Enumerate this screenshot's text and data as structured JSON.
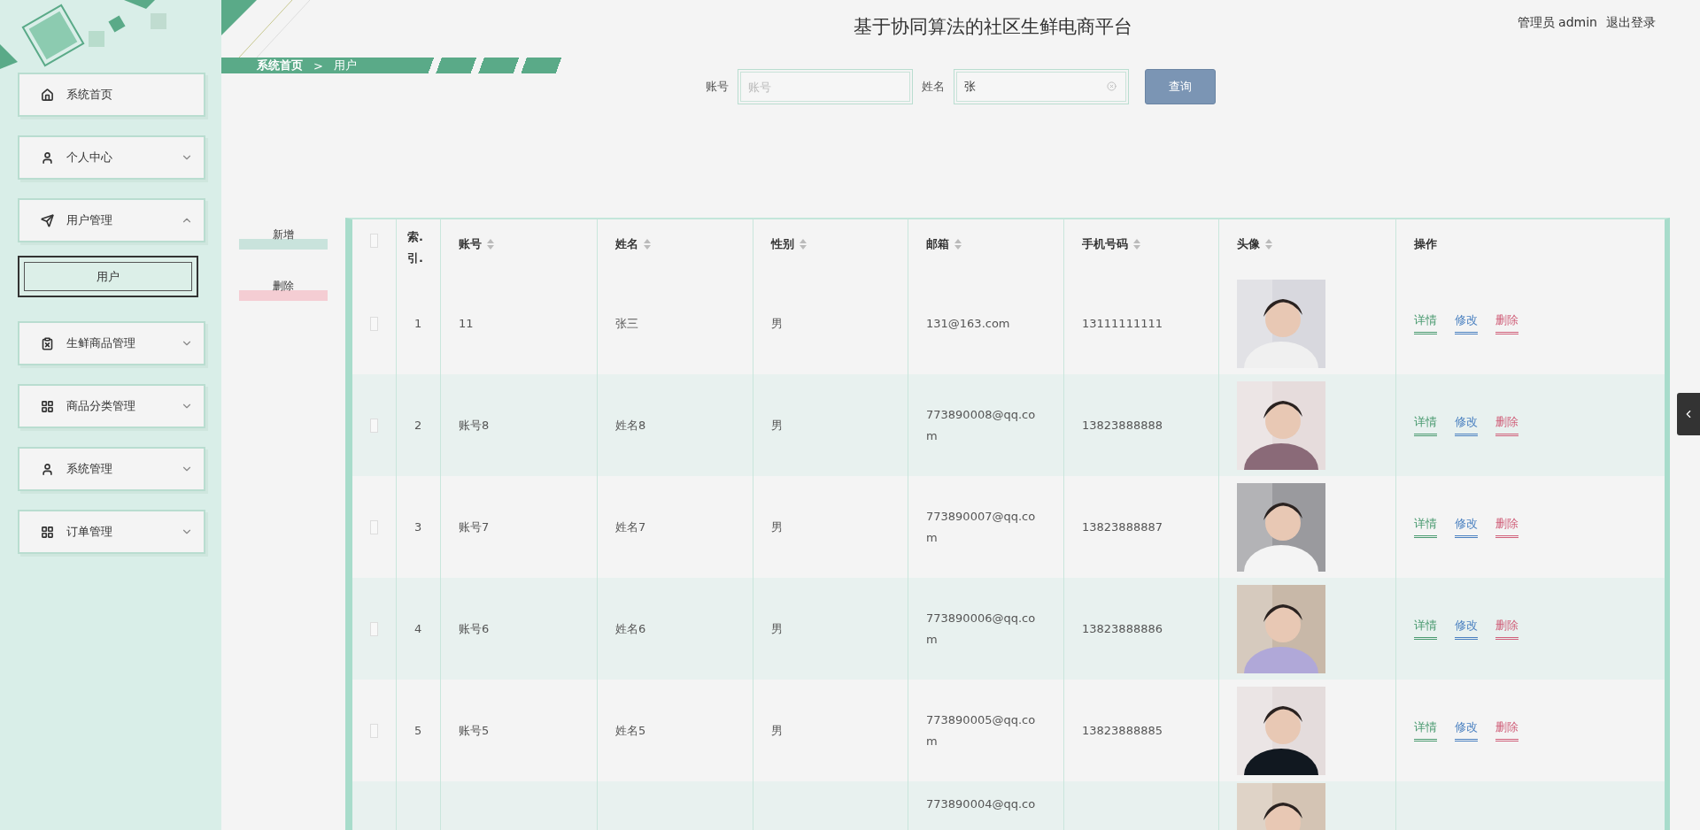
{
  "header": {
    "title": "基于协同算法的社区生鲜电商平台",
    "user_label": "管理员 admin",
    "logout": "退出登录"
  },
  "breadcrumb": [
    "系统首页",
    "用户"
  ],
  "breadcrumb_separator": ">",
  "sidebar": {
    "items": [
      {
        "label": "系统首页",
        "kind": "home"
      },
      {
        "label": "个人中心",
        "kind": "user",
        "expanded": false
      },
      {
        "label": "用户管理",
        "kind": "send",
        "expanded": true,
        "children": [
          {
            "label": "用户",
            "selected": true
          }
        ]
      },
      {
        "label": "生鲜商品管理",
        "kind": "clipboard",
        "expanded": false
      },
      {
        "label": "商品分类管理",
        "kind": "grid",
        "expanded": false
      },
      {
        "label": "系统管理",
        "kind": "user",
        "expanded": false
      },
      {
        "label": "订单管理",
        "kind": "grid",
        "expanded": false
      }
    ]
  },
  "search": {
    "fields": [
      {
        "label": "账号",
        "placeholder": "账号"
      },
      {
        "label": "姓名",
        "value": "张"
      }
    ],
    "button": "查询"
  },
  "actions": [
    {
      "label": "新增",
      "kind": "add"
    },
    {
      "label": "删除",
      "kind": "delete"
    }
  ],
  "table": {
    "select_all_checked": false,
    "columns": [
      {
        "label": "索.引.",
        "sortable": false
      },
      {
        "label": "账号",
        "sortable": true
      },
      {
        "label": "姓名",
        "sortable": true
      },
      {
        "label": "性别",
        "sortable": true
      },
      {
        "label": "邮箱",
        "sortable": true
      },
      {
        "label": "手机号码",
        "sortable": true
      },
      {
        "label": "头像",
        "sortable": true
      },
      {
        "label": "操作",
        "sortable": false
      }
    ],
    "rows": [
      {
        "index": "1",
        "account": "11",
        "name": "张三",
        "gender": "男",
        "email": "131@163.com",
        "phone": "13111111111",
        "checked": false,
        "actions": [
          {
            "label": "详情",
            "kind": "detail"
          },
          {
            "label": "修改",
            "kind": "edit"
          },
          {
            "label": "删除",
            "kind": "delete"
          }
        ]
      },
      {
        "index": "2",
        "account": "账号8",
        "name": "姓名8",
        "gender": "男",
        "email": "773890008@qq.com",
        "phone": "13823888888",
        "checked": false,
        "actions": [
          {
            "label": "详情",
            "kind": "detail"
          },
          {
            "label": "修改",
            "kind": "edit"
          },
          {
            "label": "删除",
            "kind": "delete"
          }
        ]
      },
      {
        "index": "3",
        "account": "账号7",
        "name": "姓名7",
        "gender": "男",
        "email": "773890007@qq.com",
        "phone": "13823888887",
        "checked": false,
        "actions": [
          {
            "label": "详情",
            "kind": "detail"
          },
          {
            "label": "修改",
            "kind": "edit"
          },
          {
            "label": "删除",
            "kind": "delete"
          }
        ]
      },
      {
        "index": "4",
        "account": "账号6",
        "name": "姓名6",
        "gender": "男",
        "email": "773890006@qq.com",
        "phone": "13823888886",
        "checked": false,
        "actions": [
          {
            "label": "详情",
            "kind": "detail"
          },
          {
            "label": "修改",
            "kind": "edit"
          },
          {
            "label": "删除",
            "kind": "delete"
          }
        ]
      },
      {
        "index": "5",
        "account": "账号5",
        "name": "姓名5",
        "gender": "男",
        "email": "773890005@qq.com",
        "phone": "13823888885",
        "checked": false,
        "actions": [
          {
            "label": "详情",
            "kind": "detail"
          },
          {
            "label": "修改",
            "kind": "edit"
          },
          {
            "label": "删除",
            "kind": "delete"
          }
        ]
      },
      {
        "email": "773890004@qq.co"
      }
    ]
  }
}
